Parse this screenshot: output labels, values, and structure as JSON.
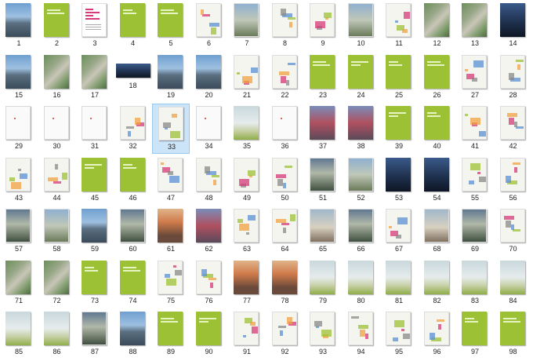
{
  "view": {
    "selected_page": "33",
    "pages": [
      {
        "label": "1",
        "kind": "city"
      },
      {
        "label": "2",
        "kind": "green"
      },
      {
        "label": "3",
        "kind": "text"
      },
      {
        "label": "4",
        "kind": "green"
      },
      {
        "label": "5",
        "kind": "green"
      },
      {
        "label": "6",
        "kind": "map"
      },
      {
        "label": "7",
        "kind": "photo"
      },
      {
        "label": "8",
        "kind": "map"
      },
      {
        "label": "9",
        "kind": "map"
      },
      {
        "label": "10",
        "kind": "photo"
      },
      {
        "label": "11",
        "kind": "map"
      },
      {
        "label": "12",
        "kind": "aerial"
      },
      {
        "label": "13",
        "kind": "aerial"
      },
      {
        "label": "14",
        "kind": "dark"
      },
      {
        "label": "15",
        "kind": "city"
      },
      {
        "label": "16",
        "kind": "aerial"
      },
      {
        "label": "17",
        "kind": "aerial"
      },
      {
        "label": "18",
        "kind": "landscape"
      },
      {
        "label": "19",
        "kind": "city"
      },
      {
        "label": "20",
        "kind": "city"
      },
      {
        "label": "21",
        "kind": "map"
      },
      {
        "label": "22",
        "kind": "map"
      },
      {
        "label": "23",
        "kind": "green"
      },
      {
        "label": "24",
        "kind": "green"
      },
      {
        "label": "25",
        "kind": "green"
      },
      {
        "label": "26",
        "kind": "green"
      },
      {
        "label": "27",
        "kind": "map"
      },
      {
        "label": "28",
        "kind": "map"
      },
      {
        "label": "29",
        "kind": "blank"
      },
      {
        "label": "30",
        "kind": "blank"
      },
      {
        "label": "31",
        "kind": "blank"
      },
      {
        "label": "32",
        "kind": "map"
      },
      {
        "label": "33",
        "kind": "map"
      },
      {
        "label": "34",
        "kind": "blank"
      },
      {
        "label": "35",
        "kind": "sky"
      },
      {
        "label": "36",
        "kind": "blank"
      },
      {
        "label": "37",
        "kind": "red"
      },
      {
        "label": "38",
        "kind": "red"
      },
      {
        "label": "39",
        "kind": "green"
      },
      {
        "label": "40",
        "kind": "green"
      },
      {
        "label": "41",
        "kind": "map"
      },
      {
        "label": "42",
        "kind": "map"
      },
      {
        "label": "43",
        "kind": "map"
      },
      {
        "label": "44",
        "kind": "map"
      },
      {
        "label": "45",
        "kind": "green"
      },
      {
        "label": "46",
        "kind": "green"
      },
      {
        "label": "47",
        "kind": "map"
      },
      {
        "label": "48",
        "kind": "map"
      },
      {
        "label": "49",
        "kind": "map"
      },
      {
        "label": "50",
        "kind": "map"
      },
      {
        "label": "51",
        "kind": "photo"
      },
      {
        "label": "52",
        "kind": "photo"
      },
      {
        "label": "53",
        "kind": "dark"
      },
      {
        "label": "54",
        "kind": "dark"
      },
      {
        "label": "55",
        "kind": "map"
      },
      {
        "label": "56",
        "kind": "map"
      },
      {
        "label": "57",
        "kind": "photo"
      },
      {
        "label": "58",
        "kind": "photo"
      },
      {
        "label": "59",
        "kind": "city"
      },
      {
        "label": "60",
        "kind": "photo"
      },
      {
        "label": "61",
        "kind": "sunset"
      },
      {
        "label": "62",
        "kind": "red"
      },
      {
        "label": "63",
        "kind": "map"
      },
      {
        "label": "64",
        "kind": "map"
      },
      {
        "label": "65",
        "kind": "photo"
      },
      {
        "label": "66",
        "kind": "photo"
      },
      {
        "label": "67",
        "kind": "map"
      },
      {
        "label": "68",
        "kind": "photo"
      },
      {
        "label": "69",
        "kind": "photo"
      },
      {
        "label": "70",
        "kind": "map"
      },
      {
        "label": "71",
        "kind": "aerial"
      },
      {
        "label": "72",
        "kind": "aerial"
      },
      {
        "label": "73",
        "kind": "green"
      },
      {
        "label": "74",
        "kind": "green"
      },
      {
        "label": "75",
        "kind": "map"
      },
      {
        "label": "76",
        "kind": "map"
      },
      {
        "label": "77",
        "kind": "sunset"
      },
      {
        "label": "78",
        "kind": "sunset"
      },
      {
        "label": "79",
        "kind": "sky"
      },
      {
        "label": "80",
        "kind": "sky"
      },
      {
        "label": "81",
        "kind": "sky"
      },
      {
        "label": "82",
        "kind": "sky"
      },
      {
        "label": "83",
        "kind": "sky"
      },
      {
        "label": "84",
        "kind": "sky"
      },
      {
        "label": "85",
        "kind": "sky"
      },
      {
        "label": "86",
        "kind": "sky"
      },
      {
        "label": "87",
        "kind": "photo"
      },
      {
        "label": "88",
        "kind": "city"
      },
      {
        "label": "89",
        "kind": "green"
      },
      {
        "label": "90",
        "kind": "green"
      },
      {
        "label": "91",
        "kind": "map"
      },
      {
        "label": "92",
        "kind": "map"
      },
      {
        "label": "93",
        "kind": "map"
      },
      {
        "label": "94",
        "kind": "map"
      },
      {
        "label": "95",
        "kind": "map"
      },
      {
        "label": "96",
        "kind": "map"
      },
      {
        "label": "97",
        "kind": "green"
      },
      {
        "label": "98",
        "kind": "green"
      }
    ]
  }
}
